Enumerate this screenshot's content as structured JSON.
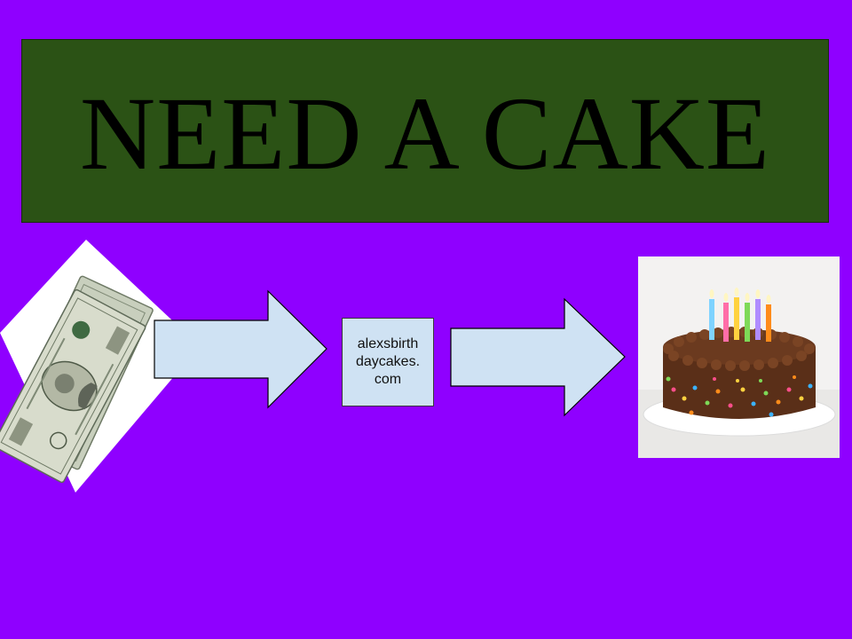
{
  "slide": {
    "background_color": "#8f00ff",
    "title": "NEED A CAKE",
    "title_box_color": "#2b5215",
    "website_box_text": "alexsbirth\ndaycakes.\ncom",
    "flow_box_fill": "#cfe2f3",
    "images": [
      {
        "name": "money-image",
        "depicts": "stack of hundred dollar bills"
      },
      {
        "name": "cake-image",
        "depicts": "chocolate birthday cake with candles and sprinkles"
      }
    ],
    "arrows": [
      "arrow-right-icon",
      "arrow-right-icon"
    ]
  }
}
